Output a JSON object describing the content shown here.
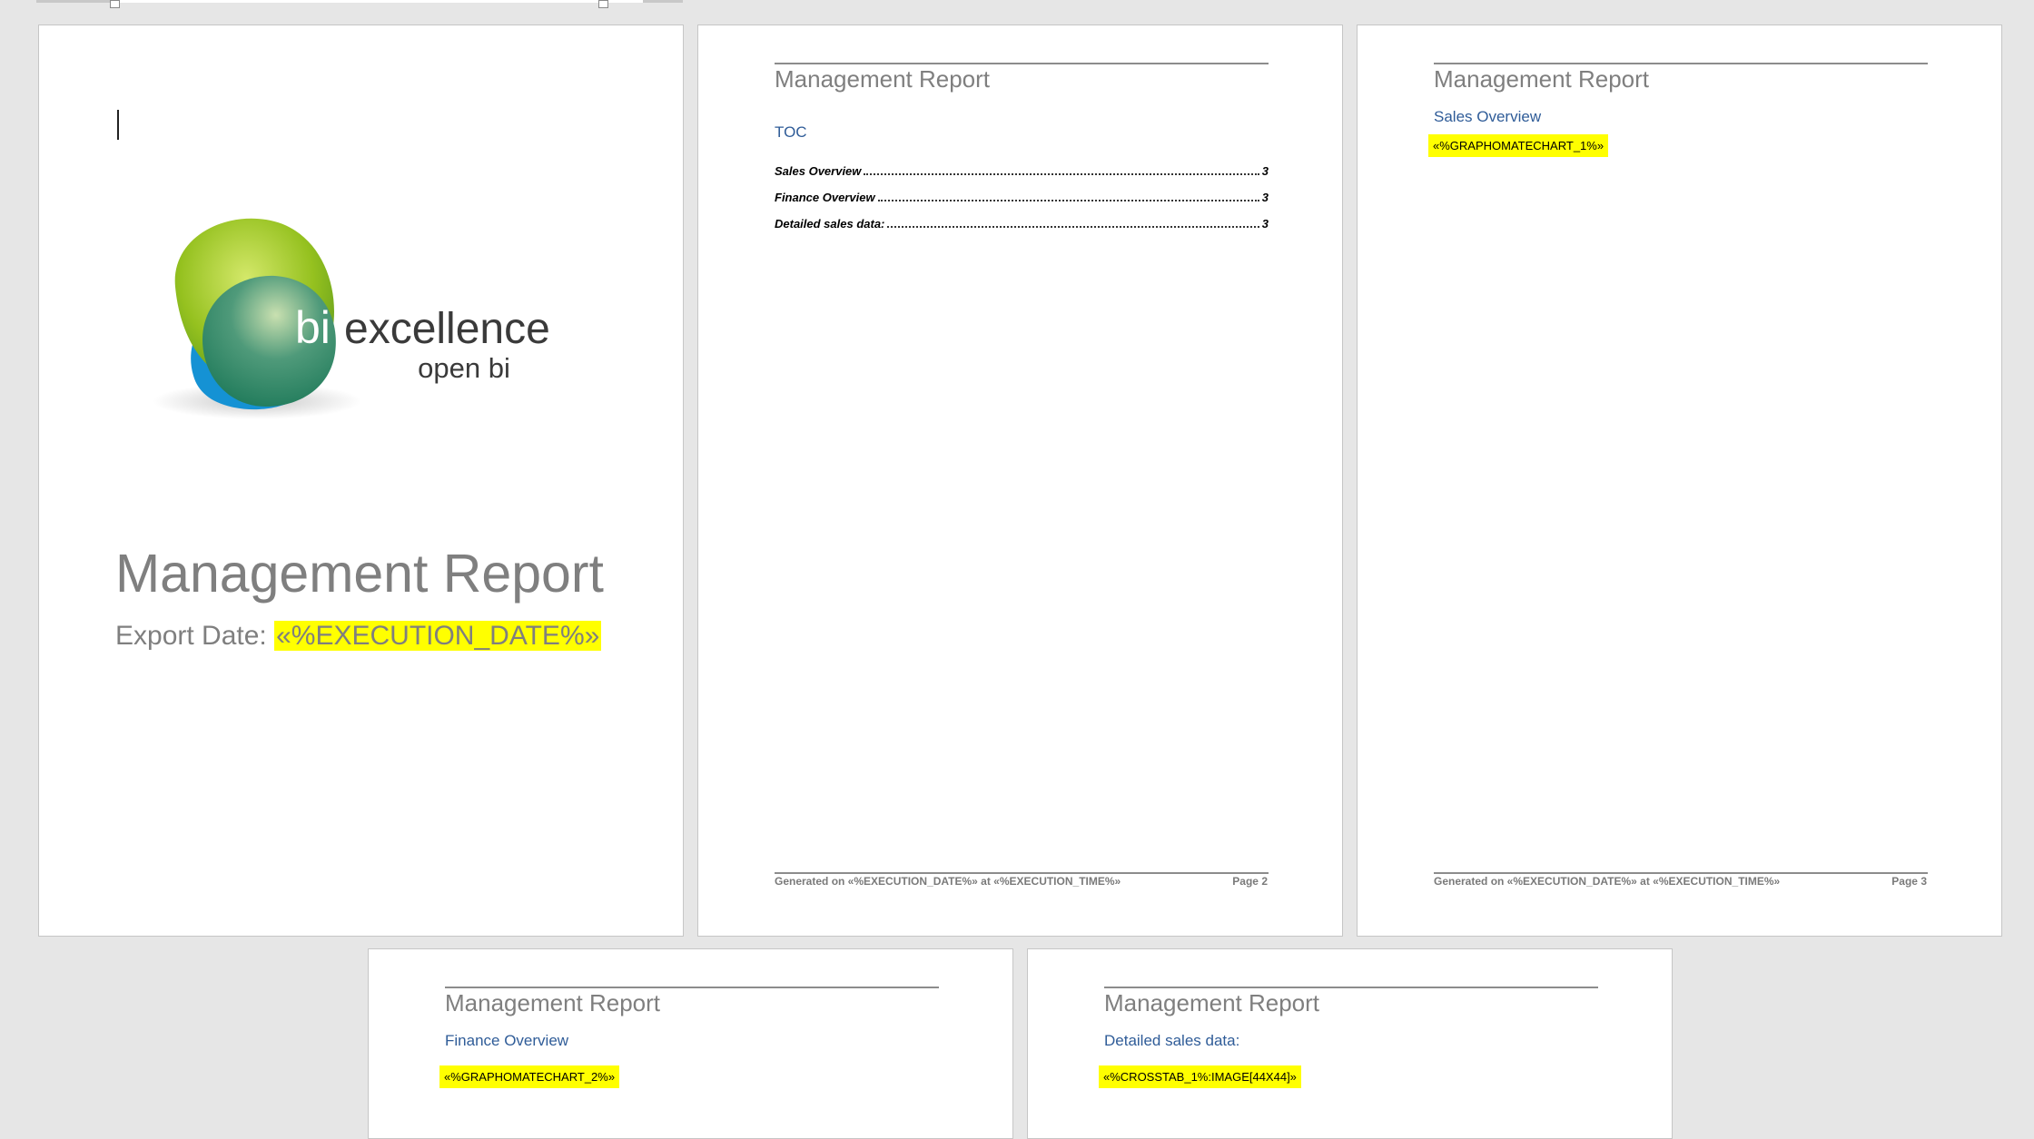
{
  "document": {
    "report_title": "Management Report",
    "cover": {
      "logo_primary": "bi",
      "logo_secondary": "excellence",
      "logo_tagline": "open bi",
      "export_label": "Export Date:",
      "export_value": "«%EXECUTION_DATE%»"
    },
    "toc": {
      "heading": "TOC",
      "entries": [
        {
          "label": "Sales Overview",
          "page": "3"
        },
        {
          "label": "Finance Overview",
          "page": "3"
        },
        {
          "label": "Detailed sales data:",
          "page": "3"
        }
      ]
    },
    "sections": [
      {
        "heading": "Sales Overview",
        "field": "«%GRAPHOMATECHART_1%»"
      },
      {
        "heading": "Finance Overview",
        "field": "«%GRAPHOMATECHART_2%»"
      },
      {
        "heading": "Detailed sales data:",
        "field": "«%CROSSTAB_1%:IMAGE[44X44]»"
      }
    ],
    "footer": {
      "generated": "Generated on «%EXECUTION_DATE%» at «%EXECUTION_TIME%»",
      "page2": "Page 2",
      "page3": "Page 3"
    }
  },
  "colors": {
    "highlight": "#ffff00",
    "heading": "#2f5c98",
    "title_gray": "#7f7f7f",
    "canvas": "#e6e6e6"
  }
}
